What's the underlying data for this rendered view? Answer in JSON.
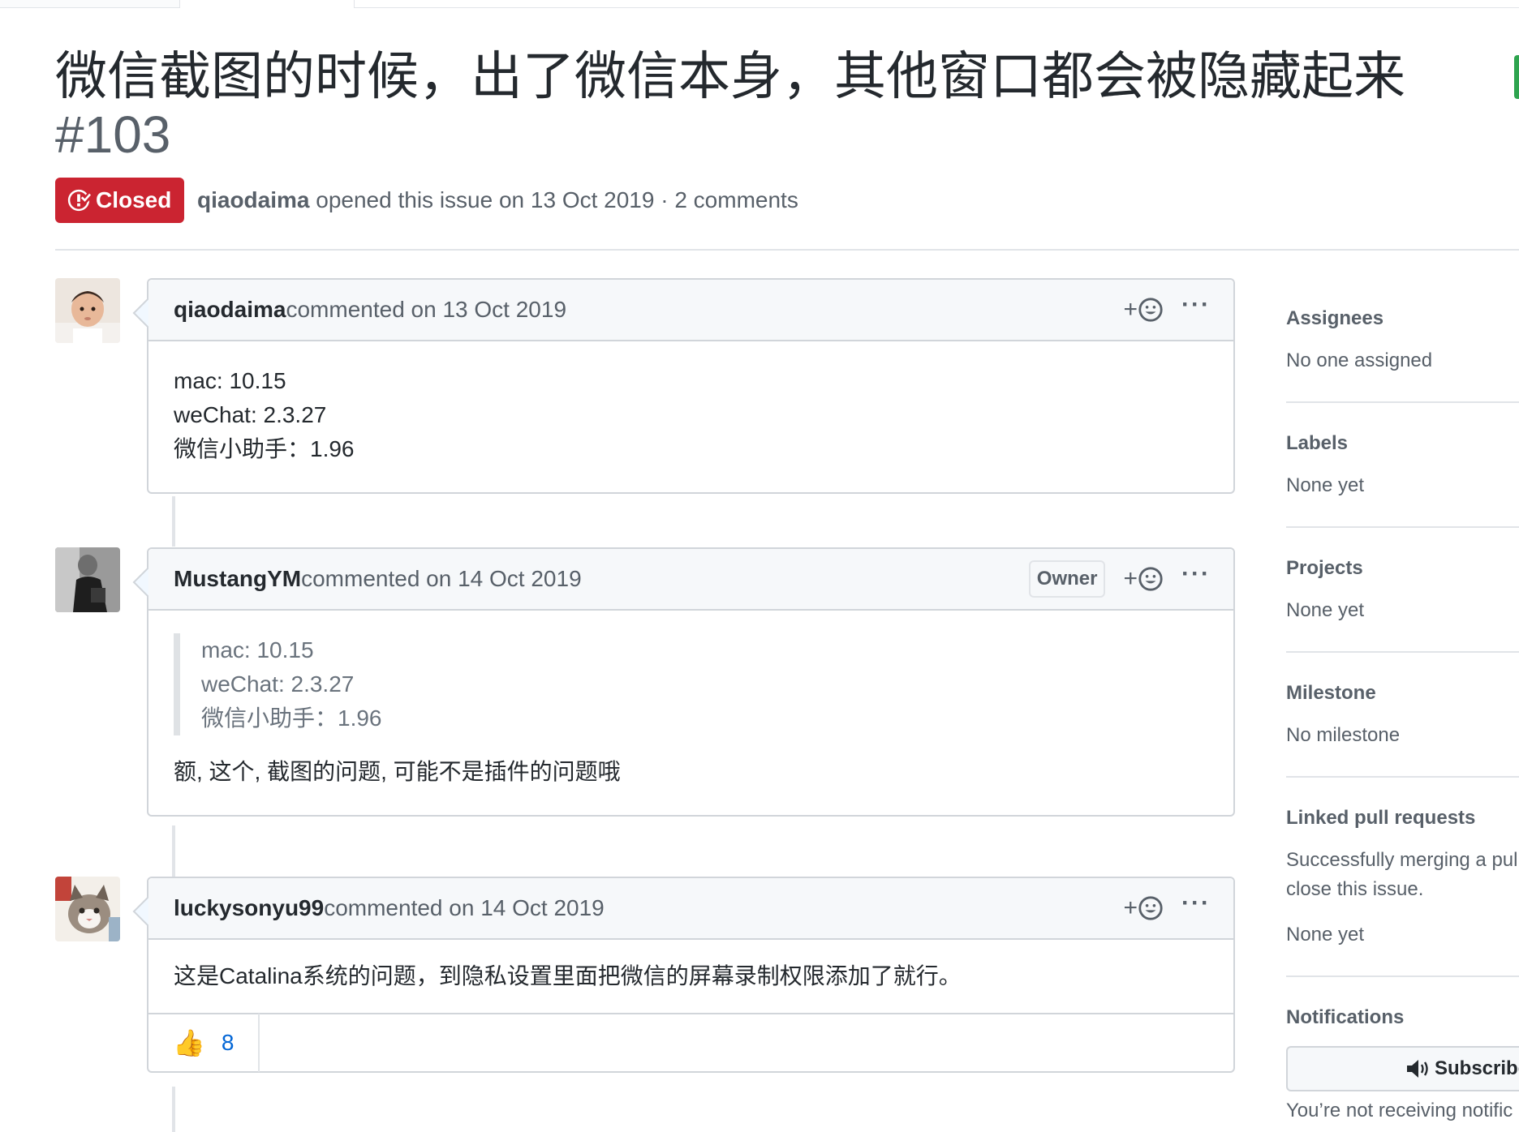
{
  "issue": {
    "title": "微信截图的时候，出了微信本身，其他窗口都会被隐藏起来",
    "number": "#103",
    "state": "Closed",
    "author": "qiaodaima",
    "meta_text": " opened this issue on 13 Oct 2019 · 2 comments"
  },
  "comments": [
    {
      "author": "qiaodaima",
      "meta": " commented on 13 Oct 2019",
      "lines": [
        "mac: 10.15",
        "weChat: 2.3.27",
        "微信小助手：1.96"
      ]
    },
    {
      "author": "MustangYM",
      "meta": " commented on 14 Oct 2019",
      "badge": "Owner",
      "quote_lines": [
        "mac: 10.15",
        "weChat: 2.3.27",
        "微信小助手：1.96"
      ],
      "text": "额, 这个, 截图的问题, 可能不是插件的问题哦"
    },
    {
      "author": "luckysonyu99",
      "meta": " commented on 14 Oct 2019",
      "text": "这是Catalina系统的问题，到隐私设置里面把微信的屏幕录制权限添加了就行。",
      "reactions": [
        {
          "emoji": "👍",
          "count": "8"
        }
      ]
    }
  ],
  "sidebar": {
    "assignees": {
      "heading": "Assignees",
      "value": "No one assigned"
    },
    "labels": {
      "heading": "Labels",
      "value": "None yet"
    },
    "projects": {
      "heading": "Projects",
      "value": "None yet"
    },
    "milestone": {
      "heading": "Milestone",
      "value": "No milestone"
    },
    "linked_prs": {
      "heading": "Linked pull requests",
      "line1": "Successfully merging a pul",
      "line2": "close this issue.",
      "value": "None yet"
    },
    "notifications": {
      "heading": "Notifications",
      "button_label": "Subscribe",
      "status": "You’re not receiving notific"
    }
  },
  "colors": {
    "closed_red": "#cb2431",
    "link_blue": "#0366d6",
    "muted_gray": "#586069",
    "border_gray": "#d1d5da"
  }
}
